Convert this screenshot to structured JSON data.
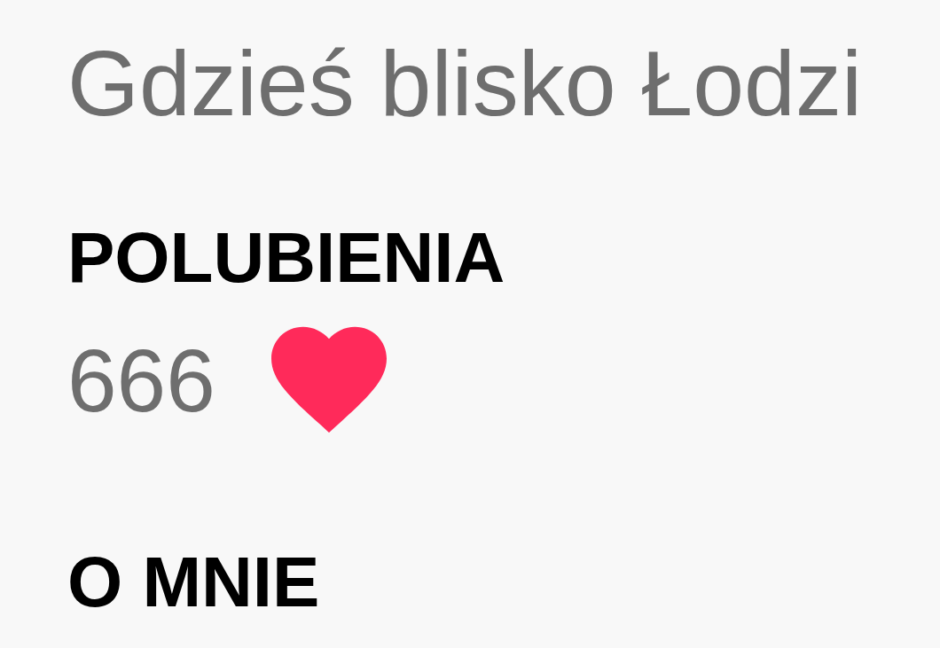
{
  "location": "Gdzieś blisko Łodzi",
  "likes": {
    "heading": "POLUBIENIA",
    "count": "666"
  },
  "about": {
    "heading": "O MNIE"
  }
}
